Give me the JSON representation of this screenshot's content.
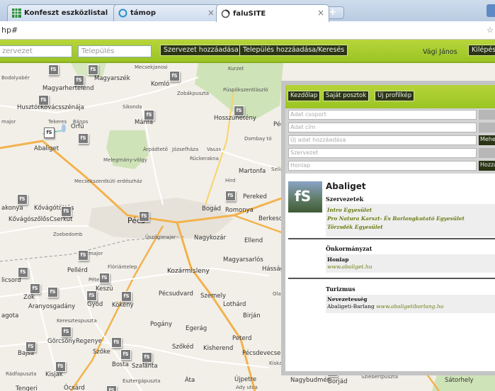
{
  "browser": {
    "tabs": [
      {
        "title": "Konfeszt eszközlistal",
        "icon": "spreadsheet-icon"
      },
      {
        "title": "támop",
        "icon": "circle-icon"
      },
      {
        "title": "faluSITE",
        "icon": "loading-icon"
      }
    ],
    "new_tab": "+",
    "url": "hp#",
    "url_end": "☆"
  },
  "toolbar": {
    "search_org_placeholder": "zervezet",
    "search_town_placeholder": "Település",
    "add_org": "Szervezet hozzáadása",
    "add_town": "Település hozzáadása/Keresés",
    "user": "Vági János",
    "logout": "Kilépés"
  },
  "map": {
    "labels": [
      {
        "t": "Bodolyabér",
        "c": ""
      },
      {
        "t": "Magyarhertelend",
        "c": ""
      },
      {
        "t": "Magyarszék",
        "c": ""
      },
      {
        "t": "Mecsekjanosi",
        "c": ""
      },
      {
        "t": "Komló",
        "c": ""
      },
      {
        "t": "Kurzet",
        "c": ""
      },
      {
        "t": "Zobákpuszta",
        "c": ""
      },
      {
        "t": "Püspökszentlászló",
        "c": ""
      },
      {
        "t": "Husztót",
        "c": ""
      },
      {
        "t": "Kovácsszénája",
        "c": ""
      },
      {
        "t": "Sikonda",
        "c": ""
      },
      {
        "t": "Mánfa",
        "c": ""
      },
      {
        "t": "Hosszúhetény",
        "c": ""
      },
      {
        "t": "Pécs",
        "c": ""
      },
      {
        "t": "Tekeres",
        "c": ""
      },
      {
        "t": "Bános",
        "c": ""
      },
      {
        "t": "major",
        "c": ""
      },
      {
        "t": "Abaliget",
        "c": ""
      },
      {
        "t": "Orfű",
        "c": ""
      },
      {
        "t": "Dombay tó",
        "c": ""
      },
      {
        "t": "Árpádtető",
        "c": ""
      },
      {
        "t": "Józsefháza",
        "c": ""
      },
      {
        "t": "Vasas",
        "c": ""
      },
      {
        "t": "Rückerakna",
        "c": ""
      },
      {
        "t": "Melegmány-völgy",
        "c": ""
      },
      {
        "t": "Martonfa",
        "c": ""
      },
      {
        "t": "Hird",
        "c": ""
      },
      {
        "t": "Szilágy",
        "c": ""
      },
      {
        "t": "Mecsekszentkúti erdészház",
        "c": ""
      },
      {
        "t": "Pereked",
        "c": ""
      },
      {
        "t": "Romonya",
        "c": ""
      },
      {
        "t": "Bogád",
        "c": ""
      },
      {
        "t": "Kővágótöttös",
        "c": ""
      },
      {
        "t": "Kővágószőlős",
        "c": ""
      },
      {
        "t": "Cserkút",
        "c": ""
      },
      {
        "t": "akonya",
        "c": ""
      },
      {
        "t": "Pécs",
        "c": "city"
      },
      {
        "t": "Berkesd",
        "c": ""
      },
      {
        "t": "Zsebedomb",
        "c": ""
      },
      {
        "t": "Üszögimajor",
        "c": ""
      },
      {
        "t": "Nagykozár",
        "c": ""
      },
      {
        "t": "Ellend",
        "c": ""
      },
      {
        "t": "major",
        "c": ""
      },
      {
        "t": "Pellérd",
        "c": ""
      },
      {
        "t": "Flóriántelep",
        "c": ""
      },
      {
        "t": "Kozármisleny",
        "c": ""
      },
      {
        "t": "Magyarsarlós",
        "c": ""
      },
      {
        "t": "Hásságy",
        "c": ""
      },
      {
        "t": "licsord",
        "c": ""
      },
      {
        "t": "Péterg",
        "c": ""
      },
      {
        "t": "Keszü",
        "c": ""
      },
      {
        "t": "Pécsudvard",
        "c": ""
      },
      {
        "t": "Szemely",
        "c": ""
      },
      {
        "t": "Olasz",
        "c": ""
      },
      {
        "t": "Zók",
        "c": ""
      },
      {
        "t": "Aranyosgadány",
        "c": ""
      },
      {
        "t": "Gyód",
        "c": ""
      },
      {
        "t": "Kökény",
        "c": ""
      },
      {
        "t": "Lothárd",
        "c": ""
      },
      {
        "t": "Birján",
        "c": ""
      },
      {
        "t": "agota",
        "c": ""
      },
      {
        "t": "Keresztespuszta",
        "c": ""
      },
      {
        "t": "Pogány",
        "c": ""
      },
      {
        "t": "Egerág",
        "c": ""
      },
      {
        "t": "Görcsöny",
        "c": ""
      },
      {
        "t": "Regenye",
        "c": ""
      },
      {
        "t": "Peterd",
        "c": ""
      },
      {
        "t": "Kisherend",
        "c": ""
      },
      {
        "t": "Szőke",
        "c": ""
      },
      {
        "t": "Szőkéd",
        "c": ""
      },
      {
        "t": "Pécsdevecser",
        "c": ""
      },
      {
        "t": "Bajsa",
        "c": ""
      },
      {
        "t": "Bosta",
        "c": ""
      },
      {
        "t": "Szalánta",
        "c": ""
      },
      {
        "t": "Kiskassa",
        "c": ""
      },
      {
        "t": "Rádfapuszta",
        "c": ""
      },
      {
        "t": "Kisjak",
        "c": ""
      },
      {
        "t": "Esztergápuszta",
        "c": ""
      },
      {
        "t": "Áta",
        "c": ""
      },
      {
        "t": "Újpetre",
        "c": ""
      },
      {
        "t": "Ady utca",
        "c": ""
      },
      {
        "t": "Nagybudmér",
        "c": ""
      },
      {
        "t": "Borjád",
        "c": ""
      },
      {
        "t": "Szlebertpuszta",
        "c": ""
      },
      {
        "t": "Sátorhely",
        "c": ""
      },
      {
        "t": "Tengeri",
        "c": ""
      },
      {
        "t": "Ócsárd",
        "c": ""
      }
    ]
  },
  "panel": {
    "tabs": [
      "Kezdőlap",
      "Saját posztok",
      "Új profilkép"
    ],
    "fields": [
      "Adat csoport",
      "Adat cím",
      "Új adat hozzáadása",
      "Szervezet",
      "Honlap"
    ],
    "side_btn_1": "Mehet",
    "side_btn_2": "Hozzá",
    "logo_text": "fS",
    "title": "Abaliget",
    "sec_org": "Szervezetek",
    "orgs": [
      "Intro Egyesület",
      "Pro Natura Karszt- És Barlangkutató Egyesület",
      "Törzsdék Egyesület"
    ],
    "sec_gov": "Önkormányzat",
    "gov_key": "Honlap",
    "gov_url": "www.abaliget.hu",
    "sec_tour": "Turizmus",
    "tour_key": "Nevezetesség",
    "tour_val": "Abaligeti-Barlang",
    "tour_url": "www.abaligetibarlang.hu"
  }
}
